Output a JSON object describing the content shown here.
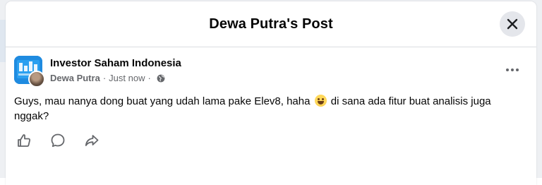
{
  "modal": {
    "title": "Dewa Putra's Post"
  },
  "post": {
    "group_name": "Investor Saham Indonesia",
    "author": "Dewa Putra",
    "separator": "·",
    "timestamp": "Just now",
    "privacy_icon": "globe-icon",
    "text_before_emoji": "Guys, mau nanya dong buat yang udah lama pake Elev8, haha ",
    "emoji": "grinning-face-emoji",
    "text_after_emoji": " di sana ada fitur buat analisis juga nggak?"
  },
  "actions": {
    "icons": [
      "like-icon",
      "comment-icon",
      "share-icon"
    ]
  },
  "colors": {
    "title_text": "#050505",
    "secondary_text": "#65676b",
    "close_button_bg": "#e4e6eb",
    "divider": "#dadde1",
    "group_avatar_bg": "#1f8be0"
  }
}
